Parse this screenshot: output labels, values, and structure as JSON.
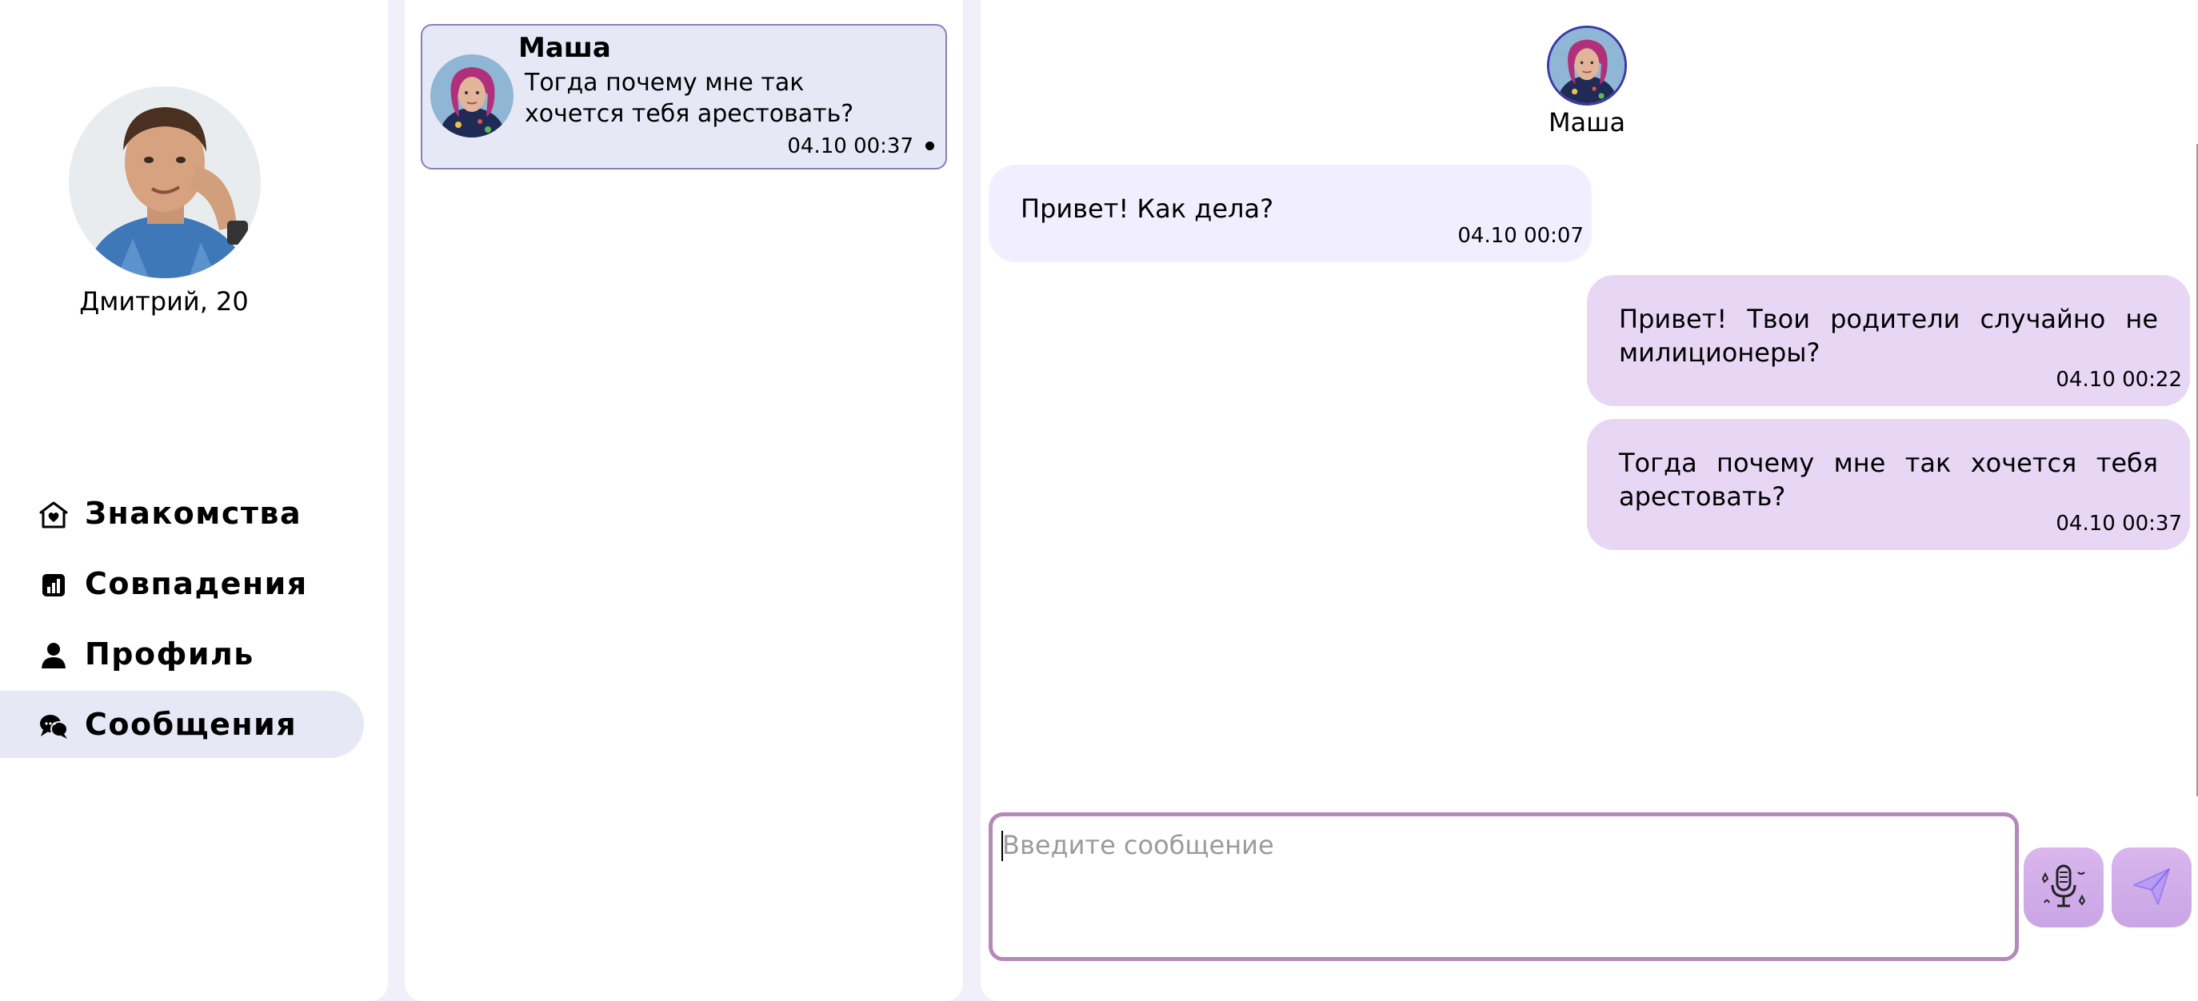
{
  "user": {
    "name_age": "Дмитрий, 20"
  },
  "nav": {
    "items": [
      {
        "label": "Знакомства",
        "icon": "home-heart-icon"
      },
      {
        "label": "Совпадения",
        "icon": "chart-icon"
      },
      {
        "label": "Профиль",
        "icon": "person-icon"
      },
      {
        "label": "Сообщения",
        "icon": "chat-bubbles-icon",
        "active": true
      }
    ]
  },
  "chat_list": {
    "items": [
      {
        "name": "Маша",
        "preview": "Тогда почему мне так хочется тебя арестовать?",
        "time": "04.10 00:37",
        "unread": true
      }
    ]
  },
  "chat": {
    "contact_name": "Маша",
    "messages": [
      {
        "direction": "in",
        "text": "Привет! Как дела?",
        "time": "04.10 00:07"
      },
      {
        "direction": "out",
        "text": "Привет! Твои родители случайно не милиционеры?",
        "time": "04.10 00:22"
      },
      {
        "direction": "out",
        "text": "Тогда почему мне так хочется тебя арестовать?",
        "time": "04.10 00:37"
      }
    ],
    "input_placeholder": "Введите сообщение",
    "mic_icon": "microphone-icon",
    "send_icon": "send-icon"
  },
  "colors": {
    "background": "#f0f0fb",
    "active_nav": "#e6e8f6",
    "incoming_bubble": "#f1efff",
    "outgoing_bubble": "#e7d7f5",
    "input_border": "#b48ab8",
    "button": "#d0aceb"
  }
}
